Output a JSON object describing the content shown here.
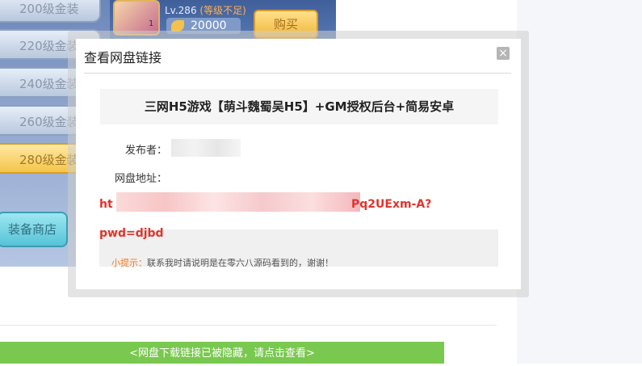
{
  "game": {
    "menu_items": [
      "200级金装",
      "220级金装",
      "240级金装",
      "260级金装",
      "280级金装"
    ],
    "hero_count": "1",
    "level": "Lv.286",
    "level_warning": "(等级不足)",
    "price": "20000",
    "buy_label": "购买",
    "shop_label": "装备商店"
  },
  "modal": {
    "title": "查看网盘链接",
    "close_label": "×",
    "heading": "三网H5游戏【萌斗魏蜀吴H5】+GM授权后台+简易安卓",
    "publisher_label": "发布者：",
    "netdisk_label": "网盘地址：",
    "link_prefix": "ht",
    "link_suffix": "Pq2UExm-A?",
    "link_line2": "pwd=djbd",
    "tip_label": "小提示：",
    "tip_text": "联系我时请说明是在零六八源码看到的，谢谢！"
  },
  "page": {
    "hidden_link_bar": "<网盘下载链接已被隐藏，请点击查看>"
  }
}
